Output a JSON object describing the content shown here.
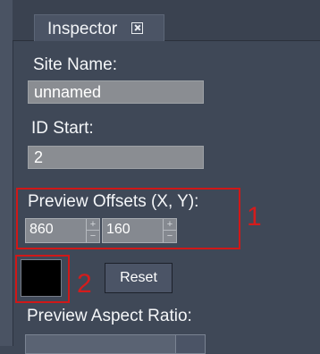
{
  "panel": {
    "tab_title": "Inspector"
  },
  "fields": {
    "site_name_label": "Site Name:",
    "site_name_value": "unnamed",
    "id_start_label": "ID Start:",
    "id_start_value": "2",
    "preview_offsets_label": "Preview Offsets (X, Y):",
    "offset_x_value": "860",
    "offset_y_value": "160",
    "reset_label": "Reset",
    "preview_aspect_label": "Preview Aspect Ratio:",
    "stepper_up": "+",
    "stepper_down": "−"
  },
  "annotations": {
    "marker_1": "1",
    "marker_2": "2",
    "color": "#d01818"
  },
  "colors": {
    "panel_bg": "#3f4857",
    "field_bg": "#8a8d92",
    "swatch": "#000000"
  }
}
